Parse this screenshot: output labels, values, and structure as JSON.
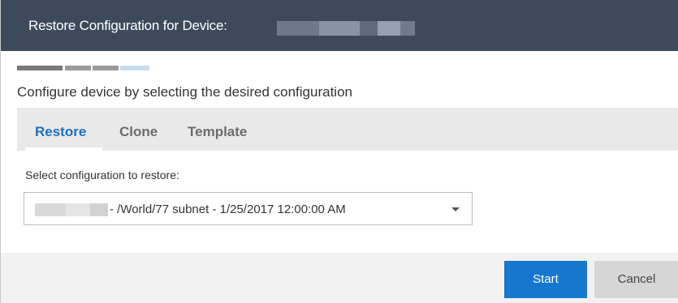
{
  "dialog": {
    "title": "Restore Configuration for Device:",
    "subtitle": "Configure device by selecting the desired configuration"
  },
  "tabs": [
    {
      "label": "Restore",
      "active": true
    },
    {
      "label": "Clone",
      "active": false
    },
    {
      "label": "Template",
      "active": false
    }
  ],
  "restore": {
    "label": "Select configuration to restore:",
    "selected_value": "- /World/77 subnet - 1/25/2017 12:00:00 AM"
  },
  "footer": {
    "start_label": "Start",
    "cancel_label": "Cancel"
  },
  "colors": {
    "titlebar": "#3c4a5b",
    "accent": "#1677cf",
    "active_tab": "#1f6fbf",
    "tab_bar": "#e9e9e9"
  }
}
